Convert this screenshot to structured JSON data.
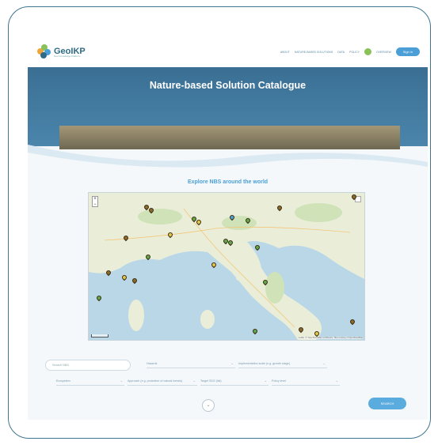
{
  "nav": {
    "logo_text": "GeoIKP",
    "logo_sub": "Geo Knowledge Platform",
    "links": [
      "ABOUT",
      "NATURE-BASED SOLUTIONS",
      "DATA",
      "POLICY"
    ],
    "profile_label": "OVERVIEW",
    "signin_label": "Sign in"
  },
  "hero": {
    "title": "Nature-based Solution Catalogue"
  },
  "map_section": {
    "title": "Explore NBS around the world",
    "zoom_in": "+",
    "zoom_out": "−",
    "attribution": "Leaflet | © OpenStreetMap contributors, Tiles courtesy of OpenStreetMap"
  },
  "filters": {
    "search_placeholder": "Search NBS",
    "field1": "Hazards",
    "field2": "Implementation scale (e.g. growth stage)",
    "field3": "Ecosystem",
    "field4": "Approach (e.g. protection of natural forests)",
    "field5": "Target SDG (list)",
    "field6": "Policy level",
    "more_label": "⌄",
    "search_label": "SEARCH"
  },
  "colors": {
    "accent": "#4b9fd6",
    "hero": "#3a6f93",
    "frame": "#3e7690"
  }
}
